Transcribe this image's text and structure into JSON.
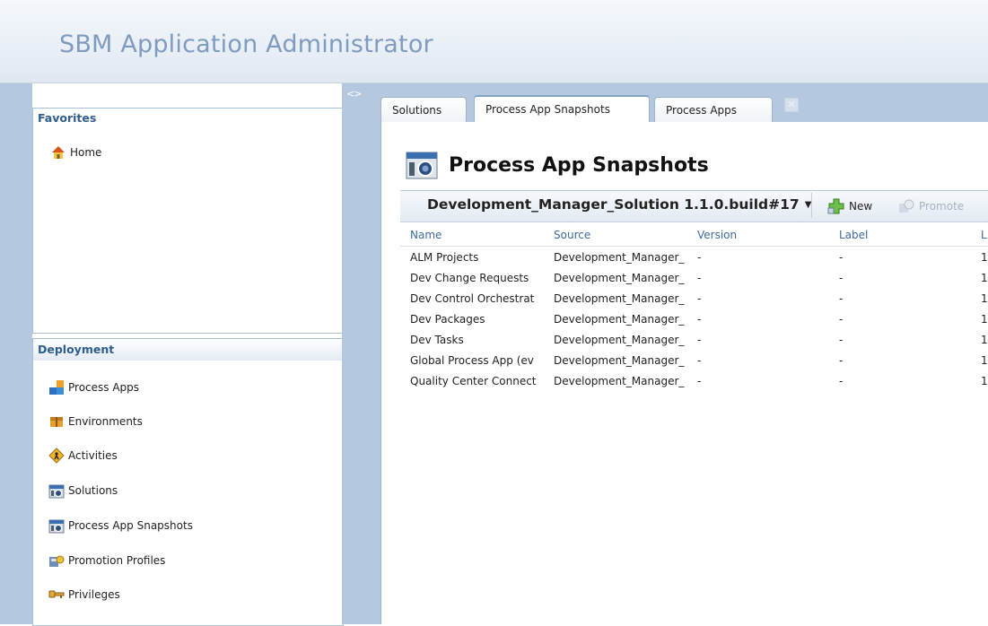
{
  "app": {
    "title": "SBM Application Administrator"
  },
  "favorites": {
    "title": "Favorites",
    "items": [
      {
        "label": "Home",
        "icon": "home-icon"
      }
    ]
  },
  "deployment": {
    "title": "Deployment",
    "items": [
      {
        "label": "Process Apps",
        "icon": "process-apps-icon"
      },
      {
        "label": "Environments",
        "icon": "environments-icon"
      },
      {
        "label": "Activities",
        "icon": "activities-icon"
      },
      {
        "label": "Solutions",
        "icon": "solutions-icon"
      },
      {
        "label": "Process App Snapshots",
        "icon": "snapshots-icon"
      },
      {
        "label": "Promotion Profiles",
        "icon": "promotion-profiles-icon"
      },
      {
        "label": "Privileges",
        "icon": "privileges-icon"
      }
    ]
  },
  "collapse_label": "<>",
  "tabs": [
    {
      "label": "Solutions",
      "active": false
    },
    {
      "label": "Process App Snapshots",
      "active": true
    },
    {
      "label": "Process Apps",
      "active": false
    }
  ],
  "page": {
    "title": "Process App Snapshots"
  },
  "toolbar": {
    "solution": "Development_Manager_Solution 1.1.0.build#17",
    "new_label": "New",
    "promote_label": "Promote"
  },
  "grid": {
    "columns": [
      "Name",
      "Source",
      "Version",
      "Label",
      "L"
    ],
    "rows": [
      {
        "name": "ALM Projects",
        "source": "Development_Manager_",
        "version": "-",
        "label": "-",
        "last": "1"
      },
      {
        "name": "Dev Change Requests",
        "source": "Development_Manager_",
        "version": "-",
        "label": "-",
        "last": "1"
      },
      {
        "name": "Dev Control Orchestrat",
        "source": "Development_Manager_",
        "version": "-",
        "label": "-",
        "last": "1"
      },
      {
        "name": "Dev Packages",
        "source": "Development_Manager_",
        "version": "-",
        "label": "-",
        "last": "1"
      },
      {
        "name": "Dev Tasks",
        "source": "Development_Manager_",
        "version": "-",
        "label": "-",
        "last": "1"
      },
      {
        "name": "Global Process App (ev",
        "source": "Development_Manager_",
        "version": "-",
        "label": "-",
        "last": "1"
      },
      {
        "name": "Quality Center Connect",
        "source": "Development_Manager_",
        "version": "-",
        "label": "-",
        "last": "1"
      }
    ]
  },
  "colors": {
    "frame": "#b4c9e0",
    "title_blue": "#7f9bbf",
    "panel_heading": "#2e5d8f",
    "column_header": "#3d6b9e"
  }
}
